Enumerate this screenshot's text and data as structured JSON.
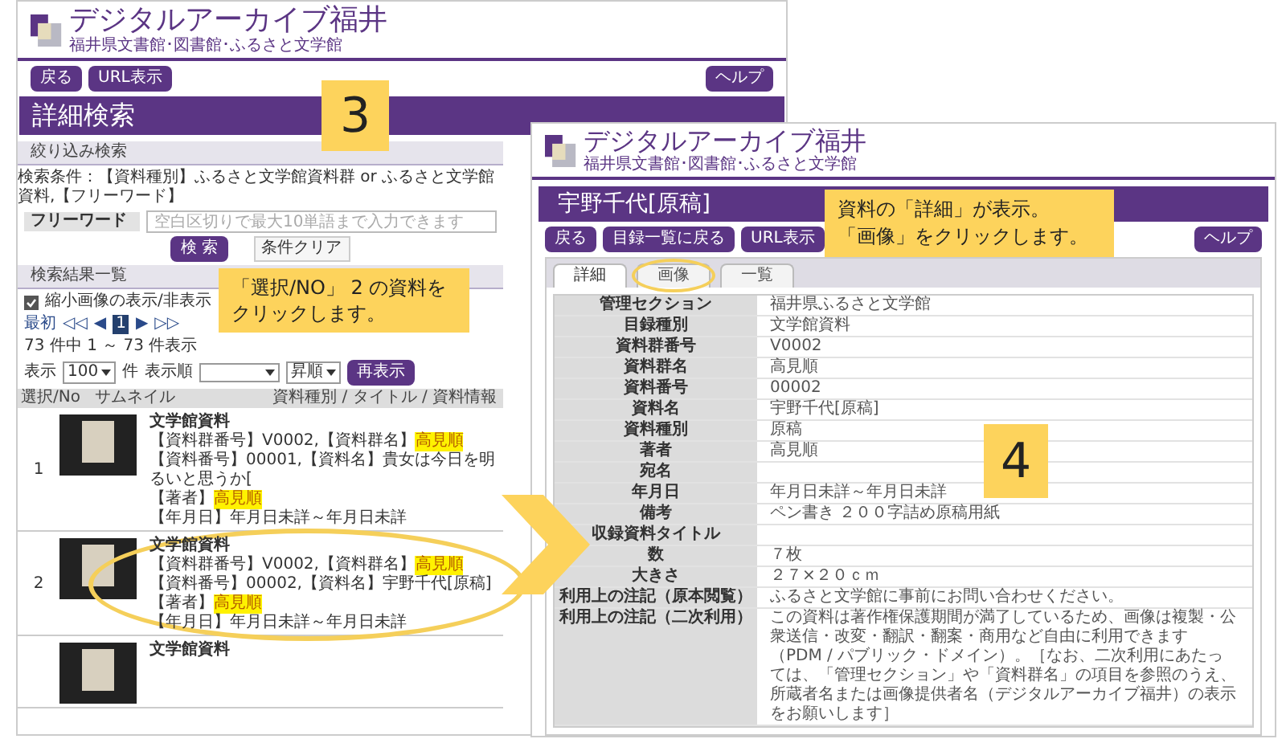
{
  "left_window": {
    "logo": {
      "title": "デジタルアーカイブ福井",
      "subtitle": "福井県文書館･図書館･ふるさと文学館"
    },
    "nav_buttons": [
      "戻る",
      "URL表示"
    ],
    "help_button": "ヘルプ",
    "page_title": "詳細検索",
    "filter_section": "絞り込み検索",
    "conditions": "検索条件：【資料種別】ふるさと文学館資料群 or ふるさと文学館資料,【フリーワード】",
    "free_word": {
      "label": "フリーワード",
      "placeholder": "空白区切りで最大10単語まで入力できます"
    },
    "search_button": "検 索",
    "clear_button": "条件クリア",
    "results_section": "検索結果一覧",
    "thumbnail_toggle": {
      "label": "縮小画像の表示/非表示",
      "checked": true
    },
    "pager": {
      "first": "最初",
      "prev_block": "◁◁",
      "prev": "◀",
      "pages": [
        {
          "label": "1",
          "selected": true
        }
      ],
      "next": "▶",
      "next_block": "▷▷"
    },
    "count": "73 件中 1 ～ 73 件表示",
    "display": {
      "label": "表示",
      "per_page": "100",
      "unit": "件",
      "sort_label": "表示順",
      "order": "昇順",
      "button": "再表示"
    },
    "table": {
      "columns": [
        "選択/No",
        "サムネイル",
        "資料種別 / タイトル / 資料情報"
      ],
      "rows": [
        {
          "no": "1",
          "circled": false,
          "type": "文学館資料",
          "lines": [
            {
              "text": "【資料群番号】V0002,【資料群名】",
              "highlight": "高見順"
            },
            {
              "text": "【資料番号】00001,【資料名】貴女は今日を明るいと思うか["
            },
            {
              "text": "【著者】",
              "highlight": "高見順"
            },
            {
              "text": "【年月日】年月日未詳～年月日未詳"
            }
          ]
        },
        {
          "no": "2",
          "circled": true,
          "type": "文学館資料",
          "lines": [
            {
              "text": "【資料群番号】V0002,【資料群名】",
              "highlight": "高見順"
            },
            {
              "text": "【資料番号】00002,【資料名】宇野千代[原稿]"
            },
            {
              "text": "【著者】",
              "highlight": "高見順"
            },
            {
              "text": "【年月日】年月日未詳～年月日未詳"
            }
          ]
        },
        {
          "circled": false,
          "type": "文学館資料",
          "lines": []
        }
      ]
    }
  },
  "right_window": {
    "logo": {
      "title": "デジタルアーカイブ福井",
      "subtitle": "福井県文書館･図書館･ふるさと文学館"
    },
    "page_title": "宇野千代[原稿]",
    "nav_buttons": [
      "戻る",
      "目録一覧に戻る",
      "URL表示"
    ],
    "help_button": "ヘルプ",
    "tabs": [
      {
        "label": "詳細",
        "selected": true,
        "circled": false
      },
      {
        "label": "画像",
        "selected": false,
        "circled": true
      },
      {
        "label": "一覧",
        "selected": false,
        "circled": false
      }
    ],
    "details": [
      {
        "label": "管理セクション",
        "value": "福井県ふるさと文学館"
      },
      {
        "label": "目録種別",
        "value": "文学館資料"
      },
      {
        "label": "資料群番号",
        "value": "V0002"
      },
      {
        "label": "資料群名",
        "value": "高見順"
      },
      {
        "label": "資料番号",
        "value": "00002"
      },
      {
        "label": "資料名",
        "value": "宇野千代[原稿]"
      },
      {
        "label": "資料種別",
        "value": "原稿"
      },
      {
        "label": "著者",
        "value": "高見順"
      },
      {
        "label": "宛名"
      },
      {
        "label": "年月日",
        "value": "年月日未詳～年月日未詳"
      },
      {
        "label": "備考",
        "value": "ペン書き ２００字詰め原稿用紙"
      },
      {
        "label": "収録資料タイトル"
      },
      {
        "label": "数",
        "value": "７枚"
      },
      {
        "label": "大きさ",
        "value": "２７×２０ｃｍ"
      },
      {
        "label": "利用上の注記（原本閲覧）",
        "value": "ふるさと文学館に事前にお問い合わせください。"
      },
      {
        "label": "利用上の注記（二次利用）",
        "value": "この資料は著作権保護期間が満了しているため、画像は複製・公衆送信・改変・翻訳・翻案・商用など自由に利用できます（PDM / パブリック・ドメイン）。［なお、二次利用にあたっては、「管理セクション」や「資料群名」の項目を参照のうえ、所蔵者名または画像提供者名（デジタルアーカイブ福井）の表示をお願いします］"
      }
    ]
  },
  "annotations": {
    "steps": [
      "3",
      "4"
    ],
    "callouts": [
      {
        "lines": [
          "「選択/NO」 2 の資料をクリックします。"
        ]
      },
      {
        "lines": [
          "資料の「詳細」が表示。",
          "「画像」をクリックします。"
        ]
      }
    ]
  }
}
